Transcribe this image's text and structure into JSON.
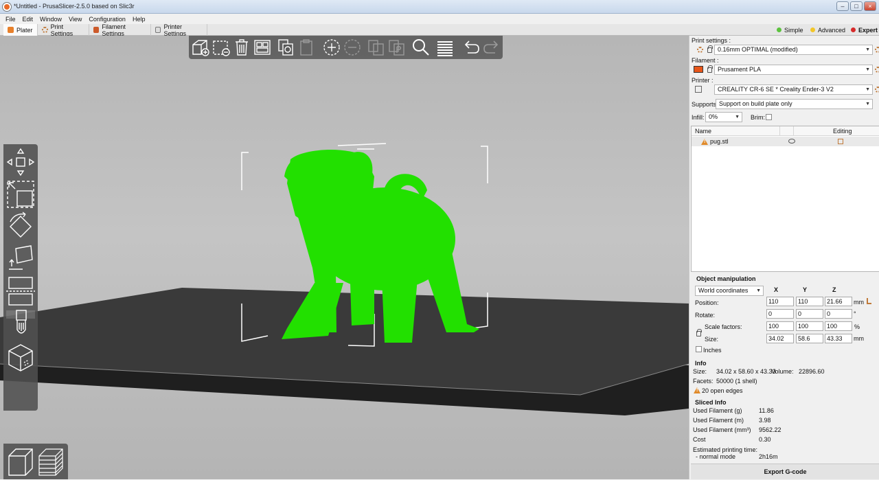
{
  "window": {
    "title": "*Untitled - PrusaSlicer-2.5.0 based on Slic3r"
  },
  "menu": [
    "File",
    "Edit",
    "Window",
    "View",
    "Configuration",
    "Help"
  ],
  "tabs": [
    {
      "label": "Plater",
      "color": "#e8802a"
    },
    {
      "label": "Print Settings",
      "color": "#d09060"
    },
    {
      "label": "Filament Settings",
      "color": "#cc5a2a"
    },
    {
      "label": "Printer Settings",
      "color": "#7a7a7a"
    }
  ],
  "modes": [
    {
      "label": "Simple",
      "color": "#5cc23e"
    },
    {
      "label": "Advanced",
      "color": "#f2c62a"
    },
    {
      "label": "Expert",
      "color": "#d62a2a"
    }
  ],
  "viewport": {
    "model_color": "#22e000",
    "bed_color": "#3a3a3a"
  },
  "panel": {
    "print_settings_label": "Print settings :",
    "print_settings_value": "0.16mm OPTIMAL (modified)",
    "filament_label": "Filament :",
    "filament_value": "Prusament PLA",
    "filament_color": "#e8561a",
    "printer_label": "Printer :",
    "printer_value": "CREALITY CR-6 SE * Creality Ender-3 V2",
    "supports_label": "Supports:",
    "supports_value": "Support on build plate only",
    "infill_label": "Infill:",
    "infill_value": "0%",
    "brim_label": "Brim:"
  },
  "object_list": {
    "col_name": "Name",
    "col_editing": "Editing",
    "items": [
      {
        "name": "pug.stl"
      }
    ]
  },
  "manipulation": {
    "title": "Object manipulation",
    "coord_system": "World coordinates",
    "axes": [
      "X",
      "Y",
      "Z"
    ],
    "position_label": "Position:",
    "position": [
      "110",
      "110",
      "21.66"
    ],
    "position_unit": "mm",
    "rotate_label": "Rotate:",
    "rotate": [
      "0",
      "0",
      "0"
    ],
    "rotate_unit": "°",
    "scale_label": "Scale factors:",
    "scale": [
      "100",
      "100",
      "100"
    ],
    "scale_unit": "%",
    "size_label": "Size:",
    "size": [
      "34.02",
      "58.6",
      "43.33"
    ],
    "size_unit": "mm",
    "inches_label": "Inches"
  },
  "info": {
    "title": "Info",
    "size_label": "Size:",
    "size_value": "34.02 x 58.60 x 43.33",
    "volume_label": "Volume:",
    "volume_value": "22896.60",
    "facets_label": "Facets:",
    "facets_value": "50000 (1 shell)",
    "open_edges": "20 open edges"
  },
  "sliced_info": {
    "title": "Sliced Info",
    "rows": [
      {
        "label": "Used Filament (g)",
        "value": "11.86"
      },
      {
        "label": "Used Filament (m)",
        "value": "3.98"
      },
      {
        "label": "Used Filament (mm³)",
        "value": "9562.22"
      },
      {
        "label": "Cost",
        "value": "0.30"
      }
    ],
    "est_label": "Estimated printing time:",
    "normal_mode_label": "- normal mode",
    "normal_mode_value": "2h16m"
  },
  "export_button": "Export G-code"
}
